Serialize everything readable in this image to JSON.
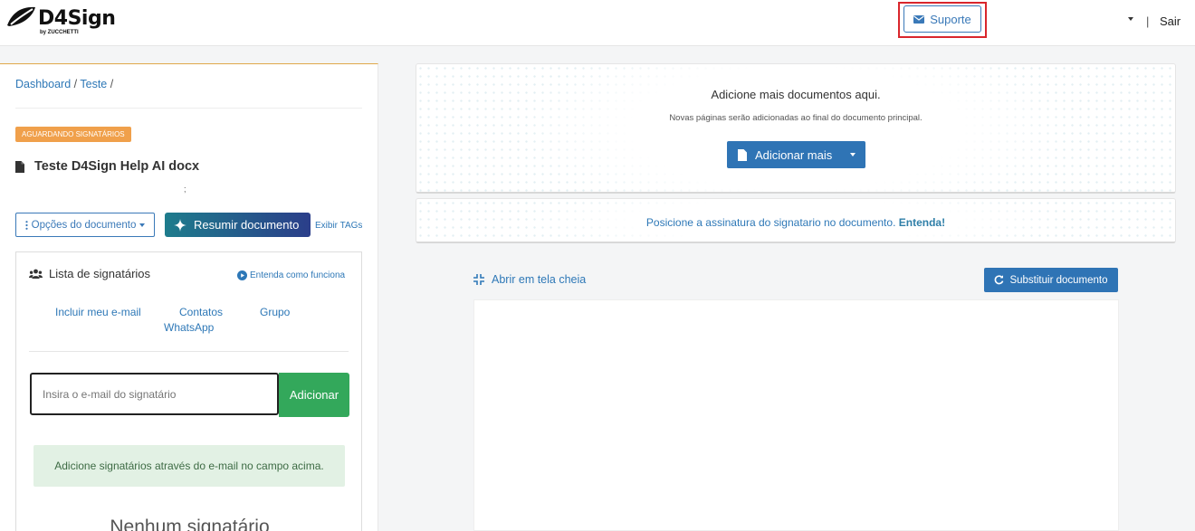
{
  "header": {
    "logo_text": "D4Sign",
    "logo_sub": "by ZUCCHETTI",
    "support_label": "Suporte",
    "separator": "|",
    "logout_label": "Sair"
  },
  "sidebar": {
    "breadcrumb": [
      "Dashboard",
      "Teste"
    ],
    "breadcrumb_sep": "/",
    "status_badge": "AGUARDANDO SIGNATÁRIOS",
    "doc_title": "Teste D4Sign Help AI docx",
    "stray_char": ";",
    "options_label": "Opções do documento",
    "summarize_label": "Resumir documento",
    "show_tags_label": "Exibir TAGs",
    "signers": {
      "title": "Lista de signatários",
      "howto_label": "Entenda como funciona",
      "tabs": [
        "Incluir meu e-mail",
        "Contatos",
        "Grupo",
        "WhatsApp"
      ],
      "email_placeholder": "Insira o e-mail do signatário",
      "add_label": "Adicionar",
      "hint": "Adicione signatários através do e-mail no campo acima.",
      "empty_title": "Nenhum signatário"
    }
  },
  "main": {
    "add_docs_title": "Adicione mais documentos aqui.",
    "add_docs_sub": "Novas páginas serão adicionadas ao final do documento principal.",
    "add_more_label": "Adicionar mais",
    "position_text": "Posicione a assinatura do signatario no documento.",
    "position_link": "Entenda!",
    "fullscreen_label": "Abrir em tela cheia",
    "replace_label": "Substituir documento"
  },
  "colors": {
    "primary": "#2f74b5",
    "link": "#2e78b7",
    "success": "#33a85b",
    "badge": "#f0a04b",
    "highlight": "#d9262c"
  }
}
